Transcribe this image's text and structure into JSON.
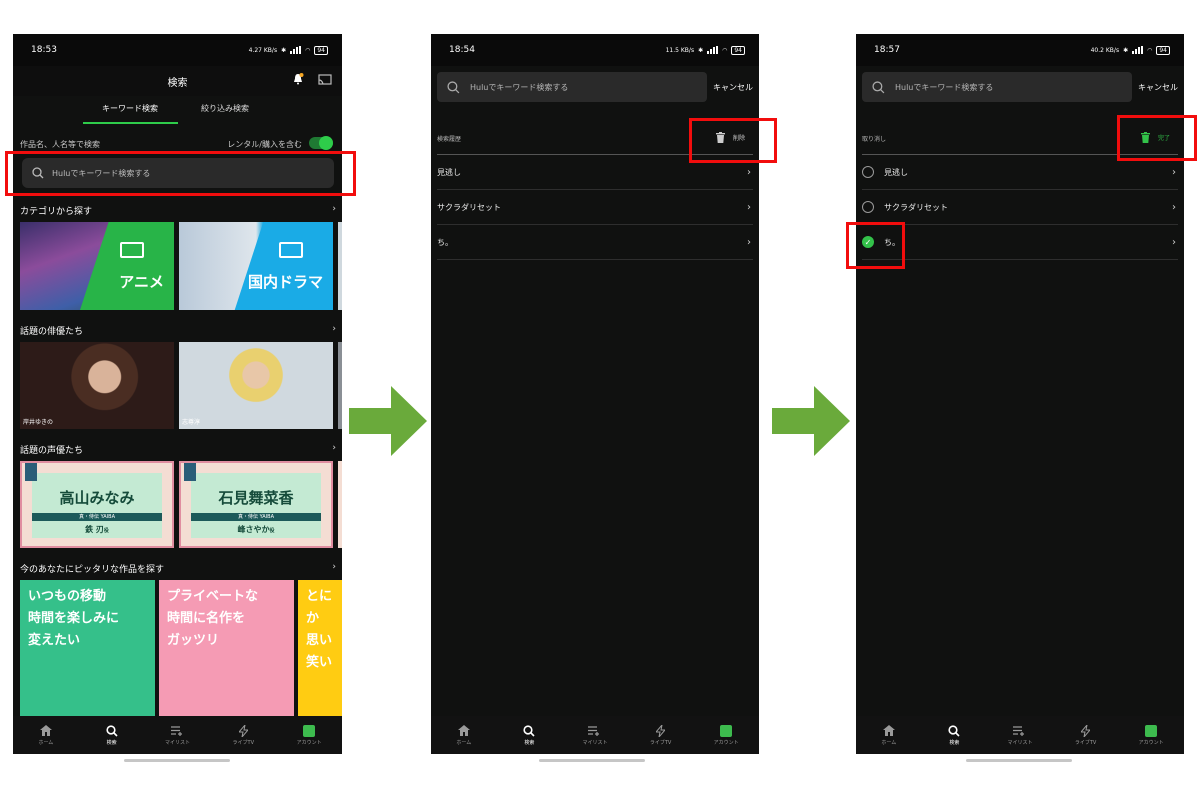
{
  "phone1": {
    "status_time": "18:53",
    "status_kbs": "4.27 KB/s",
    "battery": "94",
    "title": "検索",
    "tabs": [
      {
        "label": "キーワード検索"
      },
      {
        "label": "絞り込み検索"
      }
    ],
    "search_hint": "作品名、人名等で検索",
    "rental_label": "レンタル/購入を含む",
    "search_placeholder": "Huluでキーワード検索する",
    "sections": {
      "categories": "カテゴリから探す",
      "actors": "話題の俳優たち",
      "voice_actors": "話題の声優たち",
      "recommend": "今のあなたにピッタリな作品を探す"
    },
    "categories": [
      {
        "label": "アニメ"
      },
      {
        "label": "国内ドラマ"
      }
    ],
    "actors": [
      {
        "name": "岸井ゆきの"
      },
      {
        "name": "志尊淳"
      }
    ],
    "voice_actors": [
      {
        "name": "高山みなみ",
        "work": "真・侍伝 YAIBA",
        "role": "鉄 刃",
        "role_suffix": "役"
      },
      {
        "name": "石見舞菜香",
        "work": "真・侍伝 YAIBA",
        "role": "峰さやか",
        "role_suffix": "役"
      }
    ],
    "promos": [
      {
        "lines": [
          "いつもの移動",
          "時間を楽しみに",
          "変えたい"
        ]
      },
      {
        "lines": [
          "プライベートな",
          "時間に名作を",
          "ガッツリ"
        ]
      },
      {
        "lines": [
          "とにか",
          "思い",
          "笑い"
        ]
      }
    ]
  },
  "phone2": {
    "status_time": "18:54",
    "status_kbs": "11.5 KB/s",
    "battery": "94",
    "search_placeholder": "Huluでキーワード検索する",
    "cancel": "キャンセル",
    "history_label": "検索履歴",
    "delete": "削除",
    "items": [
      {
        "label": "見逃し"
      },
      {
        "label": "サクラダリセット"
      },
      {
        "label": "ち。"
      }
    ]
  },
  "phone3": {
    "status_time": "18:57",
    "status_kbs": "40.2 KB/s",
    "battery": "94",
    "search_placeholder": "Huluでキーワード検索する",
    "cancel": "キャンセル",
    "undo_label": "取り消し",
    "done": "完了",
    "items": [
      {
        "label": "見逃し",
        "checked": false
      },
      {
        "label": "サクラダリセット",
        "checked": false
      },
      {
        "label": "ち。",
        "checked": true
      }
    ]
  },
  "nav": [
    {
      "label": "ホーム",
      "icon": "home-icon"
    },
    {
      "label": "検索",
      "icon": "search-icon"
    },
    {
      "label": "マイリスト",
      "icon": "mylist-icon"
    },
    {
      "label": "ライブTV",
      "icon": "bolt-icon"
    },
    {
      "label": "アカウント",
      "icon": "account-icon"
    }
  ],
  "colors": {
    "accent": "#2ecc4a",
    "highlight": "#f20d0d",
    "arrow": "#6aaa3b",
    "background": "#101110"
  }
}
